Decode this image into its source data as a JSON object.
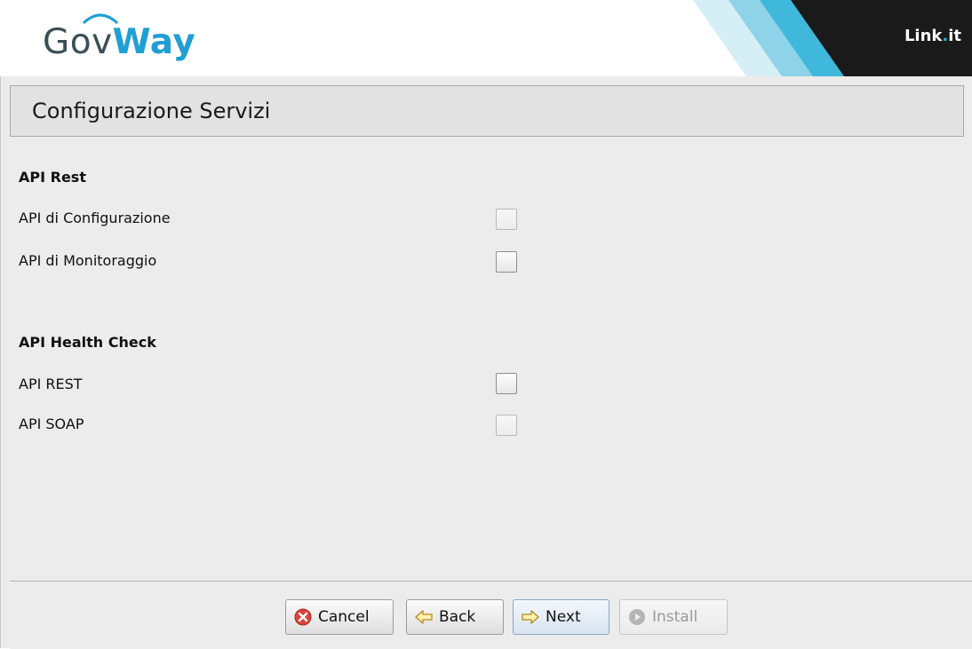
{
  "header": {
    "logo_gov": "Gov",
    "logo_way": "Way",
    "brand_main": "Link",
    "brand_dot": ".",
    "brand_end": "it"
  },
  "page": {
    "title": "Configurazione Servizi"
  },
  "sections": [
    {
      "heading": "API Rest",
      "items": [
        {
          "label": "API di Configurazione",
          "checked": false
        },
        {
          "label": "API di Monitoraggio",
          "checked": false
        }
      ]
    },
    {
      "heading": "API Health Check",
      "items": [
        {
          "label": "API REST",
          "checked": false
        },
        {
          "label": "API SOAP",
          "checked": false
        }
      ]
    }
  ],
  "buttons": {
    "cancel": "Cancel",
    "back": "Back",
    "next": "Next",
    "install": "Install"
  },
  "colors": {
    "accent": "#1f9fd3",
    "brand_bg": "#1a1a1a",
    "panel_bg": "#ececec"
  }
}
